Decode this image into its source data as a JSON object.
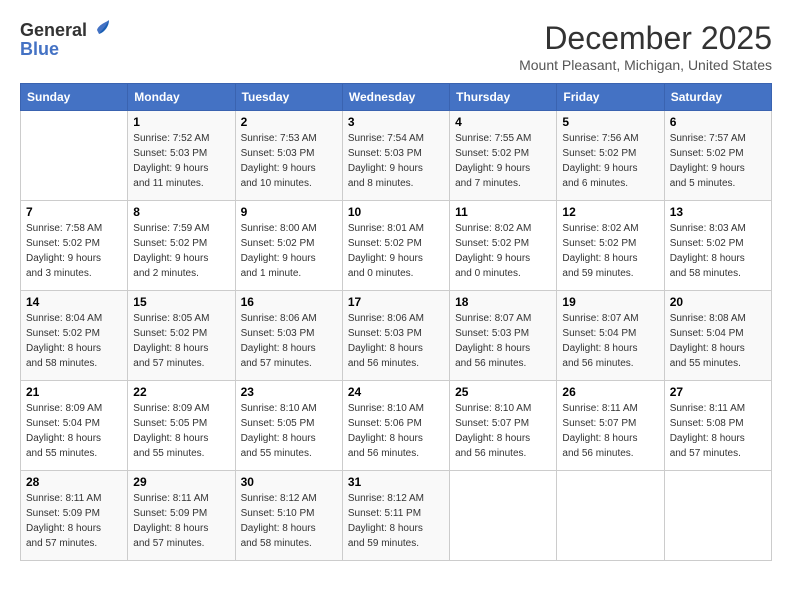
{
  "header": {
    "logo_line1": "General",
    "logo_line2": "Blue",
    "month_title": "December 2025",
    "location": "Mount Pleasant, Michigan, United States"
  },
  "calendar": {
    "days_of_week": [
      "Sunday",
      "Monday",
      "Tuesday",
      "Wednesday",
      "Thursday",
      "Friday",
      "Saturday"
    ],
    "weeks": [
      [
        {
          "day": "",
          "info": ""
        },
        {
          "day": "1",
          "info": "Sunrise: 7:52 AM\nSunset: 5:03 PM\nDaylight: 9 hours\nand 11 minutes."
        },
        {
          "day": "2",
          "info": "Sunrise: 7:53 AM\nSunset: 5:03 PM\nDaylight: 9 hours\nand 10 minutes."
        },
        {
          "day": "3",
          "info": "Sunrise: 7:54 AM\nSunset: 5:03 PM\nDaylight: 9 hours\nand 8 minutes."
        },
        {
          "day": "4",
          "info": "Sunrise: 7:55 AM\nSunset: 5:02 PM\nDaylight: 9 hours\nand 7 minutes."
        },
        {
          "day": "5",
          "info": "Sunrise: 7:56 AM\nSunset: 5:02 PM\nDaylight: 9 hours\nand 6 minutes."
        },
        {
          "day": "6",
          "info": "Sunrise: 7:57 AM\nSunset: 5:02 PM\nDaylight: 9 hours\nand 5 minutes."
        }
      ],
      [
        {
          "day": "7",
          "info": "Sunrise: 7:58 AM\nSunset: 5:02 PM\nDaylight: 9 hours\nand 3 minutes."
        },
        {
          "day": "8",
          "info": "Sunrise: 7:59 AM\nSunset: 5:02 PM\nDaylight: 9 hours\nand 2 minutes."
        },
        {
          "day": "9",
          "info": "Sunrise: 8:00 AM\nSunset: 5:02 PM\nDaylight: 9 hours\nand 1 minute."
        },
        {
          "day": "10",
          "info": "Sunrise: 8:01 AM\nSunset: 5:02 PM\nDaylight: 9 hours\nand 0 minutes."
        },
        {
          "day": "11",
          "info": "Sunrise: 8:02 AM\nSunset: 5:02 PM\nDaylight: 9 hours\nand 0 minutes."
        },
        {
          "day": "12",
          "info": "Sunrise: 8:02 AM\nSunset: 5:02 PM\nDaylight: 8 hours\nand 59 minutes."
        },
        {
          "day": "13",
          "info": "Sunrise: 8:03 AM\nSunset: 5:02 PM\nDaylight: 8 hours\nand 58 minutes."
        }
      ],
      [
        {
          "day": "14",
          "info": "Sunrise: 8:04 AM\nSunset: 5:02 PM\nDaylight: 8 hours\nand 58 minutes."
        },
        {
          "day": "15",
          "info": "Sunrise: 8:05 AM\nSunset: 5:02 PM\nDaylight: 8 hours\nand 57 minutes."
        },
        {
          "day": "16",
          "info": "Sunrise: 8:06 AM\nSunset: 5:03 PM\nDaylight: 8 hours\nand 57 minutes."
        },
        {
          "day": "17",
          "info": "Sunrise: 8:06 AM\nSunset: 5:03 PM\nDaylight: 8 hours\nand 56 minutes."
        },
        {
          "day": "18",
          "info": "Sunrise: 8:07 AM\nSunset: 5:03 PM\nDaylight: 8 hours\nand 56 minutes."
        },
        {
          "day": "19",
          "info": "Sunrise: 8:07 AM\nSunset: 5:04 PM\nDaylight: 8 hours\nand 56 minutes."
        },
        {
          "day": "20",
          "info": "Sunrise: 8:08 AM\nSunset: 5:04 PM\nDaylight: 8 hours\nand 55 minutes."
        }
      ],
      [
        {
          "day": "21",
          "info": "Sunrise: 8:09 AM\nSunset: 5:04 PM\nDaylight: 8 hours\nand 55 minutes."
        },
        {
          "day": "22",
          "info": "Sunrise: 8:09 AM\nSunset: 5:05 PM\nDaylight: 8 hours\nand 55 minutes."
        },
        {
          "day": "23",
          "info": "Sunrise: 8:10 AM\nSunset: 5:05 PM\nDaylight: 8 hours\nand 55 minutes."
        },
        {
          "day": "24",
          "info": "Sunrise: 8:10 AM\nSunset: 5:06 PM\nDaylight: 8 hours\nand 56 minutes."
        },
        {
          "day": "25",
          "info": "Sunrise: 8:10 AM\nSunset: 5:07 PM\nDaylight: 8 hours\nand 56 minutes."
        },
        {
          "day": "26",
          "info": "Sunrise: 8:11 AM\nSunset: 5:07 PM\nDaylight: 8 hours\nand 56 minutes."
        },
        {
          "day": "27",
          "info": "Sunrise: 8:11 AM\nSunset: 5:08 PM\nDaylight: 8 hours\nand 57 minutes."
        }
      ],
      [
        {
          "day": "28",
          "info": "Sunrise: 8:11 AM\nSunset: 5:09 PM\nDaylight: 8 hours\nand 57 minutes."
        },
        {
          "day": "29",
          "info": "Sunrise: 8:11 AM\nSunset: 5:09 PM\nDaylight: 8 hours\nand 57 minutes."
        },
        {
          "day": "30",
          "info": "Sunrise: 8:12 AM\nSunset: 5:10 PM\nDaylight: 8 hours\nand 58 minutes."
        },
        {
          "day": "31",
          "info": "Sunrise: 8:12 AM\nSunset: 5:11 PM\nDaylight: 8 hours\nand 59 minutes."
        },
        {
          "day": "",
          "info": ""
        },
        {
          "day": "",
          "info": ""
        },
        {
          "day": "",
          "info": ""
        }
      ]
    ]
  }
}
